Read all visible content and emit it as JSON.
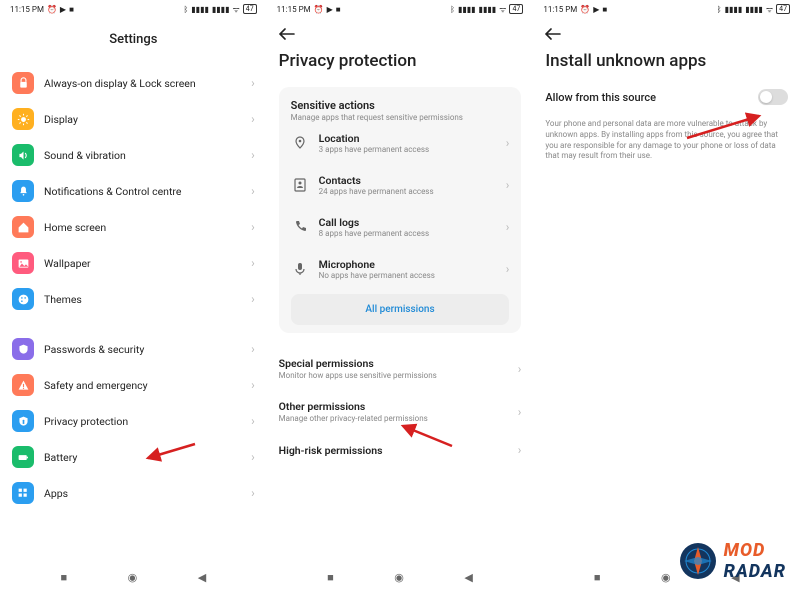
{
  "statusbar": {
    "time": "11:15 PM",
    "battery": "47"
  },
  "screen1": {
    "title": "Settings",
    "items": [
      {
        "label": "Always-on display & Lock screen",
        "color": "#ff7a59",
        "icon": "lock"
      },
      {
        "label": "Display",
        "color": "#ffb020",
        "icon": "sun"
      },
      {
        "label": "Sound & vibration",
        "color": "#1abc6b",
        "icon": "speaker"
      },
      {
        "label": "Notifications & Control centre",
        "color": "#2b9ef0",
        "icon": "bell"
      },
      {
        "label": "Home screen",
        "color": "#ff7a59",
        "icon": "home"
      },
      {
        "label": "Wallpaper",
        "color": "#ff5b7e",
        "icon": "image"
      },
      {
        "label": "Themes",
        "color": "#2b9ef0",
        "icon": "palette"
      }
    ],
    "items2": [
      {
        "label": "Passwords & security",
        "color": "#8a6de9",
        "icon": "shield"
      },
      {
        "label": "Safety and emergency",
        "color": "#ff7a59",
        "icon": "alert"
      },
      {
        "label": "Privacy protection",
        "color": "#2b9ef0",
        "icon": "privacy"
      },
      {
        "label": "Battery",
        "color": "#1abc6b",
        "icon": "battery"
      },
      {
        "label": "Apps",
        "color": "#2b9ef0",
        "icon": "apps"
      }
    ]
  },
  "screen2": {
    "title": "Privacy protection",
    "card": {
      "title": "Sensitive actions",
      "subtitle": "Manage apps that request sensitive permissions",
      "items": [
        {
          "title": "Location",
          "sub": "3 apps have permanent access",
          "icon": "location"
        },
        {
          "title": "Contacts",
          "sub": "24 apps have permanent access",
          "icon": "contacts"
        },
        {
          "title": "Call logs",
          "sub": "8 apps have permanent access",
          "icon": "phone"
        },
        {
          "title": "Microphone",
          "sub": "No apps have permanent access",
          "icon": "mic"
        }
      ],
      "all": "All permissions"
    },
    "extra": [
      {
        "title": "Special permissions",
        "sub": "Monitor how apps use sensitive permissions"
      },
      {
        "title": "Other permissions",
        "sub": "Manage other privacy-related permissions"
      },
      {
        "title": "High-risk permissions",
        "sub": ""
      }
    ]
  },
  "screen3": {
    "title": "Install unknown apps",
    "toggle_label": "Allow from this source",
    "warning": "Your phone and personal data are more vulnerable to attack by unknown apps. By installing apps from this source, you agree that you are responsible for any damage to your phone or loss of data that may result from their use."
  },
  "logo": {
    "line1": "MOD",
    "line2": "RADAR"
  }
}
